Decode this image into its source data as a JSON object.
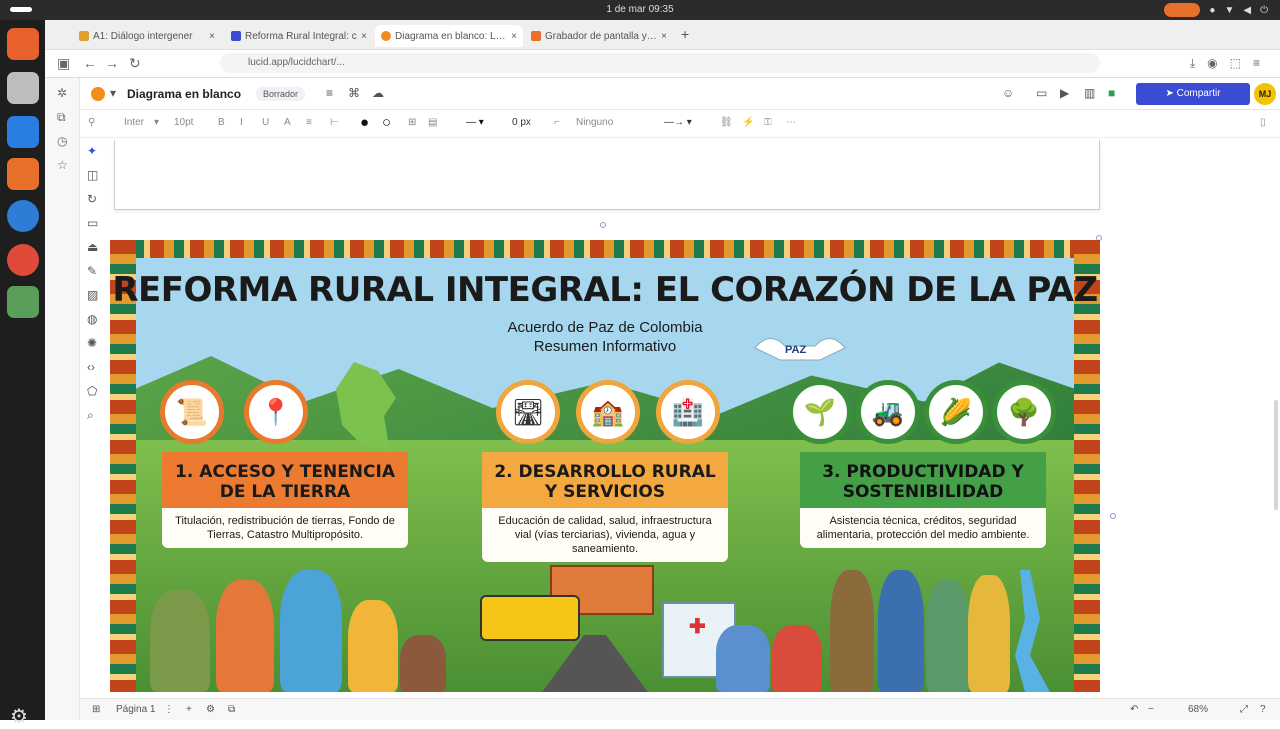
{
  "os": {
    "clock": "1 de mar 09:35"
  },
  "tabs": [
    {
      "label": "A1: Diálogo intergener",
      "color": "#e0a030"
    },
    {
      "label": "Reforma Rural Integral: c",
      "color": "#3b4bd3"
    },
    {
      "label": "Diagrama en blanco: Lucid",
      "color": "#f28c1b"
    },
    {
      "label": "Grabador de pantalla y ed",
      "color": "#e8702a"
    }
  ],
  "url": "lucid.app/lucidchart/...",
  "app": {
    "doc_title": "Diagrama en blanco",
    "status_badge": "Borrador",
    "share_label": "Compartir",
    "avatar_initials": "MJ"
  },
  "toolbar": {
    "font_name": "Inter",
    "font_size": "10pt",
    "bold": "B",
    "italic": "I",
    "underline": "U",
    "line_width": "0 px",
    "arrow_style": "Ninguno"
  },
  "infographic": {
    "title": "REFORMA RURAL INTEGRAL: EL CORAZÓN DE LA PAZ",
    "subtitle_line1": "Acuerdo de Paz de Colombia",
    "subtitle_line2": "Resumen Informativo",
    "dove_label": "PAZ",
    "pillars": [
      {
        "title_line1": "1. ACCESO Y TENENCIA",
        "title_line2": "DE LA TIERRA",
        "body": "Titulación, redistribución de tierras, Fondo de Tierras, Catastro Multipropósito."
      },
      {
        "title_line1": "2. DESARROLLO RURAL",
        "title_line2": "Y SERVICIOS",
        "body": "Educación de calidad, salud, infraestructura vial (vías terciarias), vivienda, agua y saneamiento."
      },
      {
        "title_line1": "3. PRODUCTIVIDAD Y",
        "title_line2": "SOSTENIBILIDAD",
        "body": "Asistencia técnica, créditos, seguridad alimentaria, protección del medio ambiente."
      }
    ]
  },
  "statusbar": {
    "page_label": "Página 1",
    "zoom": "68%"
  },
  "colors": {
    "accent_share": "#3b4bd3",
    "pillar1": "#ec7a31",
    "pillar2": "#f3a93f",
    "pillar3": "#43a047"
  }
}
